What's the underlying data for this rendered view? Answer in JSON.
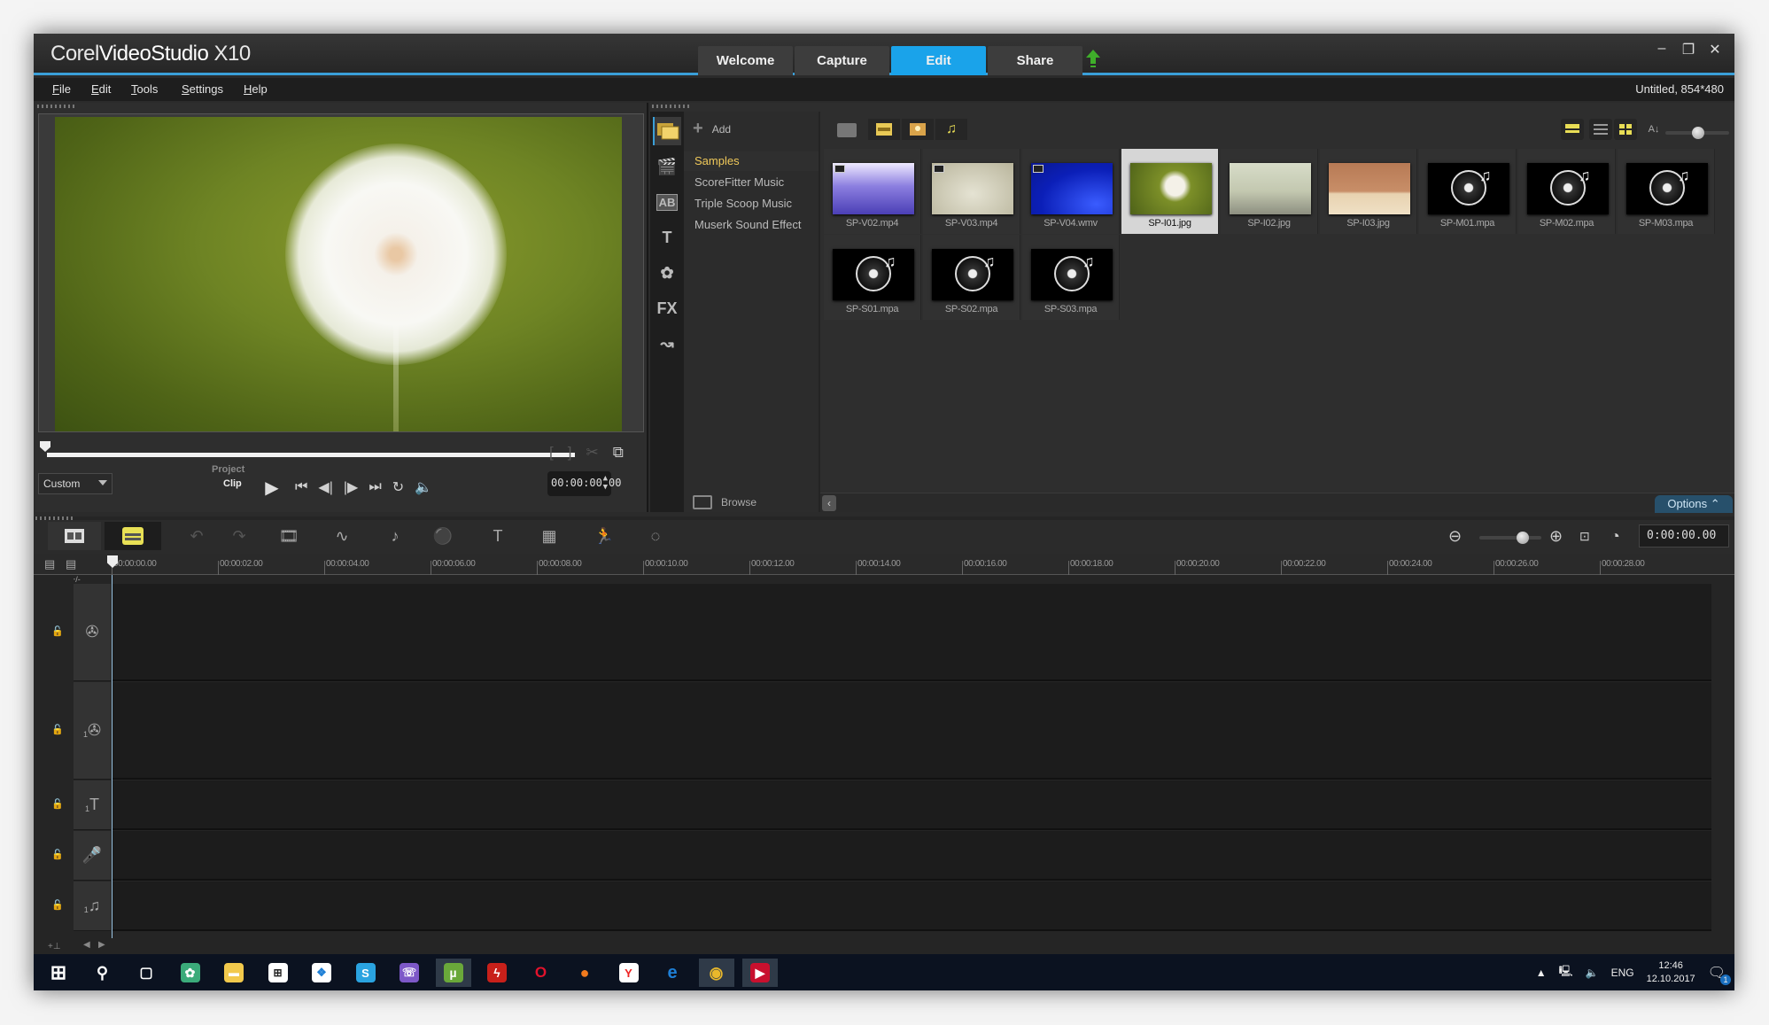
{
  "window": {
    "app_title_prefix": "Corel",
    "app_title_main": "VideoStudio",
    "app_title_suffix": "X10",
    "mode_tabs": [
      {
        "label": "Welcome",
        "active": false
      },
      {
        "label": "Capture",
        "active": false
      },
      {
        "label": "Edit",
        "active": true
      },
      {
        "label": "Share",
        "active": false
      }
    ],
    "controls": {
      "minimize": "–",
      "restore": "❐",
      "close": "✕"
    },
    "accent_color": "#1aa3ea"
  },
  "menu": {
    "items": [
      "File",
      "Edit",
      "Tools",
      "Settings",
      "Help"
    ],
    "project_info": "Untitled, 854*480"
  },
  "preview": {
    "mode_select": "Custom",
    "project_label": "Project",
    "clip_label": "Clip",
    "timecode": "00:00:00.00",
    "scrub_position": 0,
    "transport": [
      "play",
      "home",
      "previous-frame",
      "next-frame",
      "end",
      "repeat",
      "volume"
    ]
  },
  "library": {
    "add_label": "Add",
    "browse_label": "Browse",
    "options_label": "Options",
    "folders": [
      {
        "label": "Samples",
        "active": true
      },
      {
        "label": "ScoreFitter Music",
        "active": false
      },
      {
        "label": "Triple Scoop Music",
        "active": false
      },
      {
        "label": "Muserk Sound Effect",
        "active": false
      }
    ],
    "items": [
      {
        "name": "SP-V02.mp4",
        "type": "video",
        "selected": false
      },
      {
        "name": "SP-V03.mp4",
        "type": "video",
        "selected": false
      },
      {
        "name": "SP-V04.wmv",
        "type": "video",
        "selected": false
      },
      {
        "name": "SP-I01.jpg",
        "type": "image",
        "selected": true
      },
      {
        "name": "SP-I02.jpg",
        "type": "image",
        "selected": false
      },
      {
        "name": "SP-I03.jpg",
        "type": "image",
        "selected": false
      },
      {
        "name": "SP-M01.mpa",
        "type": "audio",
        "selected": false
      },
      {
        "name": "SP-M02.mpa",
        "type": "audio",
        "selected": false
      },
      {
        "name": "SP-M03.mpa",
        "type": "audio",
        "selected": false
      },
      {
        "name": "SP-S01.mpa",
        "type": "audio",
        "selected": false
      },
      {
        "name": "SP-S02.mpa",
        "type": "audio",
        "selected": false
      },
      {
        "name": "SP-S03.mpa",
        "type": "audio",
        "selected": false
      }
    ],
    "thumbnail_size": 0.45
  },
  "timeline": {
    "timecode": "0:00:00.00",
    "zoom_level": 0.6,
    "add_remove_label": "+/-",
    "ruler_ticks": [
      "00:00:00.00",
      "00:00:02.00",
      "00:00:04.00",
      "00:00:06.00",
      "00:00:08.00",
      "00:00:10.00",
      "00:00:12.00",
      "00:00:14.00",
      "00:00:16.00",
      "00:00:18.00",
      "00:00:20.00",
      "00:00:22.00",
      "00:00:24.00",
      "00:00:26.00",
      "00:00:28.00"
    ],
    "tracks": [
      {
        "name": "video-track",
        "icon": "film-reel"
      },
      {
        "name": "overlay-track",
        "icon": "film-reel",
        "index": "1"
      },
      {
        "name": "title-track",
        "icon": "T",
        "index": "1"
      },
      {
        "name": "voice-track",
        "icon": "microphone"
      },
      {
        "name": "music-track",
        "icon": "music-note",
        "index": "1"
      }
    ]
  },
  "taskbar": {
    "apps": [
      "start",
      "search",
      "task-view",
      "app-green",
      "file-explorer",
      "store",
      "dropbox",
      "skype",
      "viber",
      "utorrent",
      "flash",
      "opera",
      "firefox",
      "yandex",
      "edge",
      "chrome",
      "videostudio"
    ],
    "language": "ENG",
    "time": "12:46",
    "date": "12.10.2017",
    "notifications": "1"
  }
}
